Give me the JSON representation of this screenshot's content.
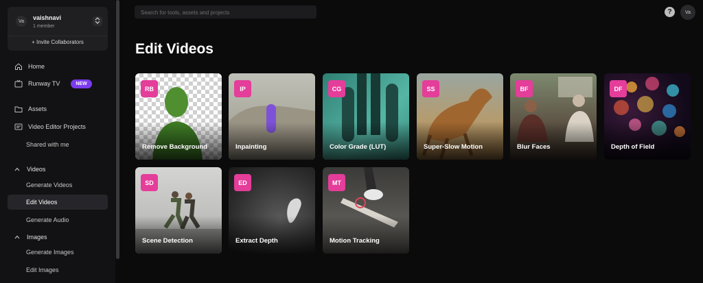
{
  "workspace": {
    "avatar": "Va",
    "name": "vaishnavi",
    "members": "1 member",
    "invite": "+ Invite Collaborators"
  },
  "nav": {
    "home": "Home",
    "runway_tv": "Runway TV",
    "new_badge": "NEW",
    "assets": "Assets",
    "video_editor_projects": "Video Editor Projects",
    "shared": "Shared with me",
    "videos_section": "Videos",
    "generate_videos": "Generate Videos",
    "edit_videos": "Edit Videos",
    "generate_audio": "Generate Audio",
    "images_section": "Images",
    "generate_images": "Generate Images",
    "edit_images": "Edit Images"
  },
  "search": {
    "placeholder": "Search for tools, assets and projects"
  },
  "header": {
    "help": "?",
    "user_avatar": "Va"
  },
  "main": {
    "title": "Edit Videos",
    "tools": [
      {
        "code": "RB",
        "label": "Remove Background"
      },
      {
        "code": "IP",
        "label": "Inpainting"
      },
      {
        "code": "CG",
        "label": "Color Grade (LUT)"
      },
      {
        "code": "SS",
        "label": "Super-Slow Motion"
      },
      {
        "code": "BF",
        "label": "Blur Faces"
      },
      {
        "code": "DF",
        "label": "Depth of Field"
      },
      {
        "code": "SD",
        "label": "Scene Detection"
      },
      {
        "code": "ED",
        "label": "Extract Depth"
      },
      {
        "code": "MT",
        "label": "Motion Tracking"
      }
    ]
  },
  "colors": {
    "accent_pink": "#e43d9a",
    "badge_purple": "#7b3cf0",
    "background": "#0b0b0c",
    "sidebar": "#121214"
  }
}
